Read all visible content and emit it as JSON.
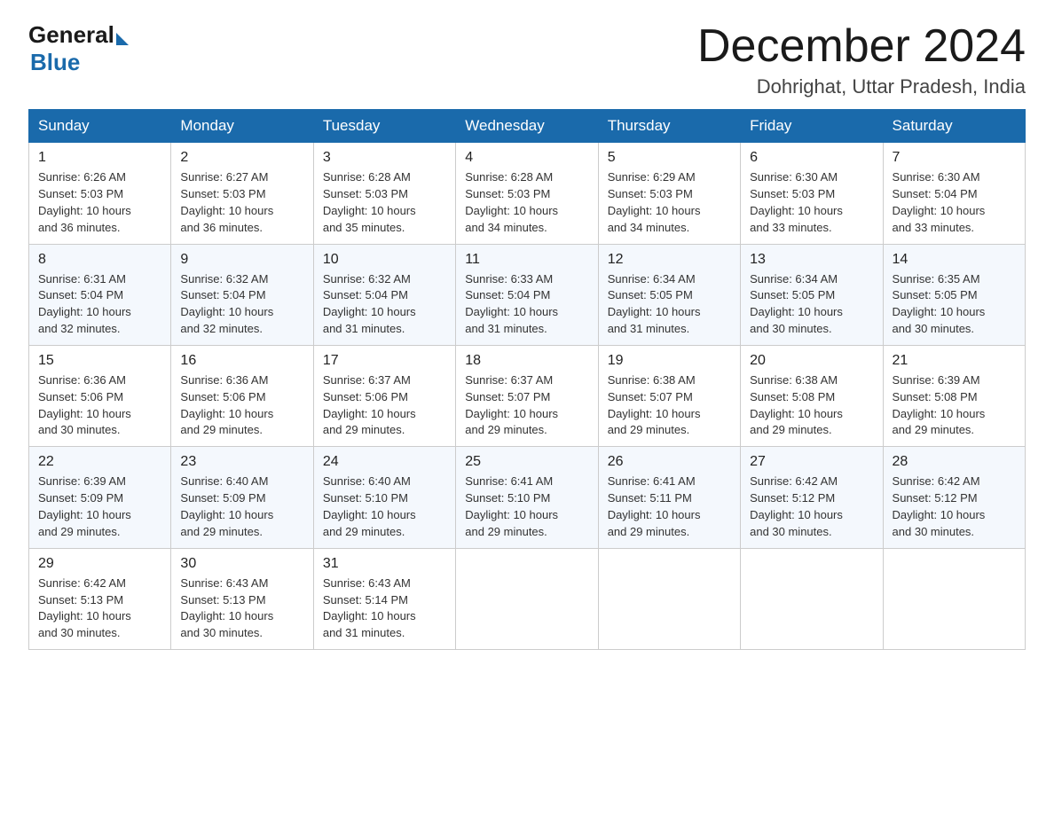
{
  "logo": {
    "general": "General",
    "blue": "Blue"
  },
  "title": "December 2024",
  "location": "Dohrighat, Uttar Pradesh, India",
  "days_of_week": [
    "Sunday",
    "Monday",
    "Tuesday",
    "Wednesday",
    "Thursday",
    "Friday",
    "Saturday"
  ],
  "weeks": [
    [
      {
        "day": "1",
        "sunrise": "6:26 AM",
        "sunset": "5:03 PM",
        "daylight": "10 hours and 36 minutes."
      },
      {
        "day": "2",
        "sunrise": "6:27 AM",
        "sunset": "5:03 PM",
        "daylight": "10 hours and 36 minutes."
      },
      {
        "day": "3",
        "sunrise": "6:28 AM",
        "sunset": "5:03 PM",
        "daylight": "10 hours and 35 minutes."
      },
      {
        "day": "4",
        "sunrise": "6:28 AM",
        "sunset": "5:03 PM",
        "daylight": "10 hours and 34 minutes."
      },
      {
        "day": "5",
        "sunrise": "6:29 AM",
        "sunset": "5:03 PM",
        "daylight": "10 hours and 34 minutes."
      },
      {
        "day": "6",
        "sunrise": "6:30 AM",
        "sunset": "5:03 PM",
        "daylight": "10 hours and 33 minutes."
      },
      {
        "day": "7",
        "sunrise": "6:30 AM",
        "sunset": "5:04 PM",
        "daylight": "10 hours and 33 minutes."
      }
    ],
    [
      {
        "day": "8",
        "sunrise": "6:31 AM",
        "sunset": "5:04 PM",
        "daylight": "10 hours and 32 minutes."
      },
      {
        "day": "9",
        "sunrise": "6:32 AM",
        "sunset": "5:04 PM",
        "daylight": "10 hours and 32 minutes."
      },
      {
        "day": "10",
        "sunrise": "6:32 AM",
        "sunset": "5:04 PM",
        "daylight": "10 hours and 31 minutes."
      },
      {
        "day": "11",
        "sunrise": "6:33 AM",
        "sunset": "5:04 PM",
        "daylight": "10 hours and 31 minutes."
      },
      {
        "day": "12",
        "sunrise": "6:34 AM",
        "sunset": "5:05 PM",
        "daylight": "10 hours and 31 minutes."
      },
      {
        "day": "13",
        "sunrise": "6:34 AM",
        "sunset": "5:05 PM",
        "daylight": "10 hours and 30 minutes."
      },
      {
        "day": "14",
        "sunrise": "6:35 AM",
        "sunset": "5:05 PM",
        "daylight": "10 hours and 30 minutes."
      }
    ],
    [
      {
        "day": "15",
        "sunrise": "6:36 AM",
        "sunset": "5:06 PM",
        "daylight": "10 hours and 30 minutes."
      },
      {
        "day": "16",
        "sunrise": "6:36 AM",
        "sunset": "5:06 PM",
        "daylight": "10 hours and 29 minutes."
      },
      {
        "day": "17",
        "sunrise": "6:37 AM",
        "sunset": "5:06 PM",
        "daylight": "10 hours and 29 minutes."
      },
      {
        "day": "18",
        "sunrise": "6:37 AM",
        "sunset": "5:07 PM",
        "daylight": "10 hours and 29 minutes."
      },
      {
        "day": "19",
        "sunrise": "6:38 AM",
        "sunset": "5:07 PM",
        "daylight": "10 hours and 29 minutes."
      },
      {
        "day": "20",
        "sunrise": "6:38 AM",
        "sunset": "5:08 PM",
        "daylight": "10 hours and 29 minutes."
      },
      {
        "day": "21",
        "sunrise": "6:39 AM",
        "sunset": "5:08 PM",
        "daylight": "10 hours and 29 minutes."
      }
    ],
    [
      {
        "day": "22",
        "sunrise": "6:39 AM",
        "sunset": "5:09 PM",
        "daylight": "10 hours and 29 minutes."
      },
      {
        "day": "23",
        "sunrise": "6:40 AM",
        "sunset": "5:09 PM",
        "daylight": "10 hours and 29 minutes."
      },
      {
        "day": "24",
        "sunrise": "6:40 AM",
        "sunset": "5:10 PM",
        "daylight": "10 hours and 29 minutes."
      },
      {
        "day": "25",
        "sunrise": "6:41 AM",
        "sunset": "5:10 PM",
        "daylight": "10 hours and 29 minutes."
      },
      {
        "day": "26",
        "sunrise": "6:41 AM",
        "sunset": "5:11 PM",
        "daylight": "10 hours and 29 minutes."
      },
      {
        "day": "27",
        "sunrise": "6:42 AM",
        "sunset": "5:12 PM",
        "daylight": "10 hours and 30 minutes."
      },
      {
        "day": "28",
        "sunrise": "6:42 AM",
        "sunset": "5:12 PM",
        "daylight": "10 hours and 30 minutes."
      }
    ],
    [
      {
        "day": "29",
        "sunrise": "6:42 AM",
        "sunset": "5:13 PM",
        "daylight": "10 hours and 30 minutes."
      },
      {
        "day": "30",
        "sunrise": "6:43 AM",
        "sunset": "5:13 PM",
        "daylight": "10 hours and 30 minutes."
      },
      {
        "day": "31",
        "sunrise": "6:43 AM",
        "sunset": "5:14 PM",
        "daylight": "10 hours and 31 minutes."
      },
      null,
      null,
      null,
      null
    ]
  ],
  "labels": {
    "sunrise": "Sunrise:",
    "sunset": "Sunset:",
    "daylight": "Daylight:"
  }
}
